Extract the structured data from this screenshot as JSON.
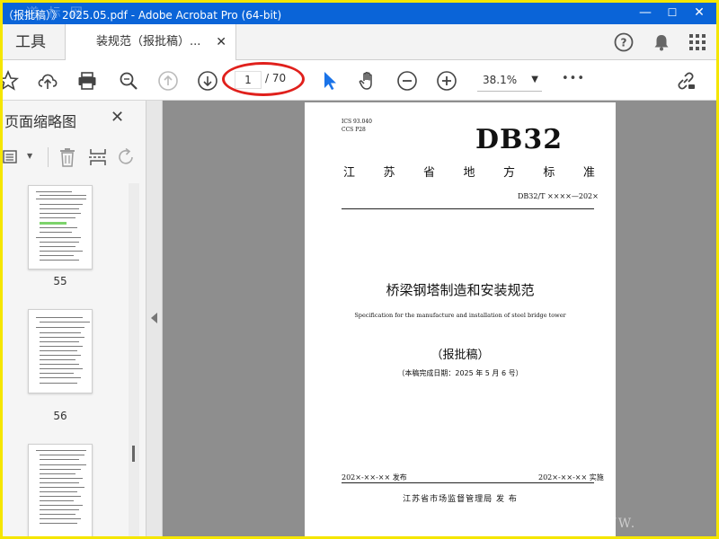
{
  "window": {
    "title": "（报批稿）》2025.05.pdf - Adobe Acrobat Pro (64-bit)",
    "controls": [
      "—",
      "☐",
      "✕"
    ]
  },
  "tabs": {
    "tools_label": "工具",
    "doc_tab_label": "装规范（报批稿）...",
    "close_symbol": "✕"
  },
  "toolbar": {
    "page_current": "1",
    "page_total": "/ 70",
    "zoom": "38.1%",
    "zoom_caret": "▼",
    "more": "•••"
  },
  "left_panel": {
    "title": "页面缩略图",
    "close_symbol": "✕",
    "thumbnails": [
      {
        "number": "55"
      },
      {
        "number": "56"
      }
    ]
  },
  "document": {
    "ics": "ICS 93.040",
    "ccs": "CCS P28",
    "db_code": "DB32",
    "standard_type_chars": [
      "江",
      "苏",
      "省",
      "地",
      "方",
      "标",
      "准"
    ],
    "std_number": "DB32/T  ××××—202×",
    "title_cn": "桥梁钢塔制造和安装规范",
    "title_en": "Specification for the manufacture and installation of steel bridge tower",
    "draft_label": "（报批稿）",
    "completion_note": "（本稿完成日期：2025 年 5 月 6 号）",
    "issue_date": "202×-××-×× 发布",
    "impl_date": "202×-××-×× 实施",
    "publisher": "江苏省市场监督管理局    发 布"
  },
  "colors": {
    "titlebar_bg": "#0a64d8",
    "frame_border": "#f5e600",
    "highlight_oval": "#e0201c",
    "doc_bg": "#8e8e8e",
    "select_cursor": "#1a73e8"
  }
}
